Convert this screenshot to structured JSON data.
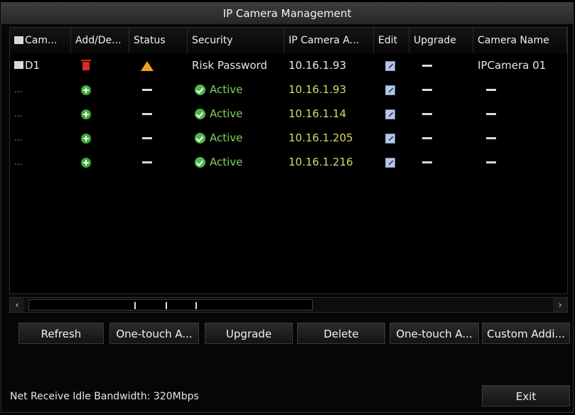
{
  "window": {
    "title": "IP Camera Management"
  },
  "columns": [
    "Cam...",
    "Add/De...",
    "Status",
    "Security",
    "IP Camera A...",
    "Edit",
    "Upgrade",
    "Camera Name"
  ],
  "rows": [
    {
      "cam": "D1",
      "action": "delete",
      "status": "warning",
      "security": "Risk Password",
      "ip": "10.16.1.93",
      "upgrade": "—",
      "camera_name": "IPCamera 01"
    },
    {
      "cam": "...",
      "action": "add",
      "status": "—",
      "security": "Active",
      "ip": "10.16.1.93",
      "upgrade": "—",
      "camera_name": "—"
    },
    {
      "cam": "...",
      "action": "add",
      "status": "—",
      "security": "Active",
      "ip": "10.16.1.14",
      "upgrade": "—",
      "camera_name": "—"
    },
    {
      "cam": "...",
      "action": "add",
      "status": "—",
      "security": "Active",
      "ip": "10.16.1.205",
      "upgrade": "—",
      "camera_name": "—"
    },
    {
      "cam": "...",
      "action": "add",
      "status": "—",
      "security": "Active",
      "ip": "10.16.1.216",
      "upgrade": "—",
      "camera_name": "—"
    }
  ],
  "scroll": {
    "left": "‹",
    "right": "›"
  },
  "buttons": {
    "refresh": "Refresh",
    "one_touch_add": "One-touch A...",
    "upgrade": "Upgrade",
    "delete": "Delete",
    "one_touch_activate": "One-touch A...",
    "custom_add": "Custom Addi...",
    "exit": "Exit"
  },
  "footer": {
    "bandwidth": "Net Receive Idle Bandwidth: 320Mbps"
  },
  "colors": {
    "active_text": "#7fd45a",
    "ip_text": "#d8d86a",
    "warning": "#f0a020",
    "delete": "#d03020",
    "add": "#3cab3c"
  }
}
